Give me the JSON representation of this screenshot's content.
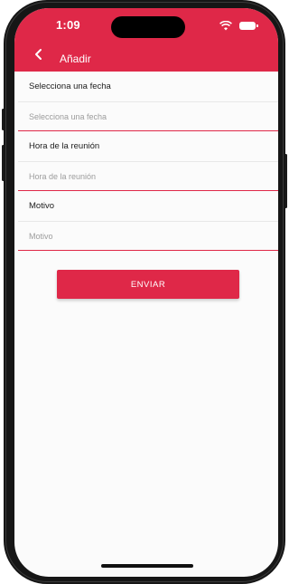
{
  "status_bar": {
    "time": "1:09"
  },
  "header": {
    "title": "Añadir",
    "back_icon": "chevron-left-icon"
  },
  "form": {
    "date": {
      "label": "Selecciona una fecha",
      "placeholder": "Selecciona una fecha"
    },
    "time": {
      "label": "Hora de la reunión",
      "placeholder": "Hora de la reunión"
    },
    "reason": {
      "label": "Motivo",
      "placeholder": "Motivo"
    },
    "submit_label": "ENVIAR"
  },
  "colors": {
    "accent": "#df2848",
    "background": "#fbfbfb"
  }
}
